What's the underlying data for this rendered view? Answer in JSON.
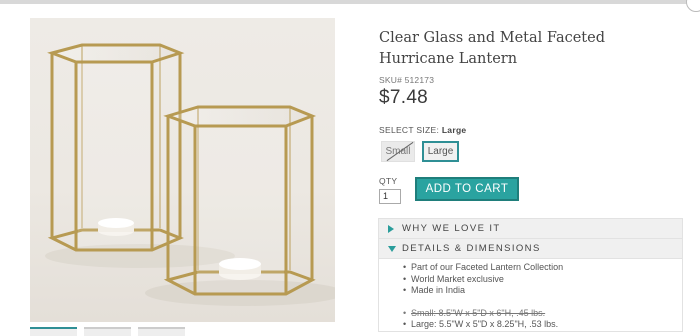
{
  "product": {
    "title": "Clear Glass and Metal Faceted Hurricane Lantern",
    "sku_label": "SKU#",
    "sku": "512173",
    "price": "$7.48"
  },
  "size": {
    "label": "SELECT SIZE:",
    "selected": "Large",
    "options": [
      "Small",
      "Large"
    ]
  },
  "qty": {
    "label": "QTY",
    "value": "1"
  },
  "cart": {
    "button_label": "ADD TO CART"
  },
  "accordion": {
    "why": "WHY WE LOVE IT",
    "details": "DETAILS & DIMENSIONS",
    "bullets": [
      "Part of our Faceted Lantern Collection",
      "World Market exclusive",
      "Made in India"
    ],
    "dims_small": "Small: 8.5\"W x 5\"D x 6\"H, .45 lbs.",
    "dims_large": "Large: 5.5\"W x 5\"D x 8.25\"H, .53 lbs."
  },
  "colors": {
    "accent": "#2aa3a0",
    "accent_dark": "#1f7e7b",
    "gold": "#b79a52"
  },
  "icons": [
    "triangle-right-icon",
    "triangle-down-icon"
  ]
}
